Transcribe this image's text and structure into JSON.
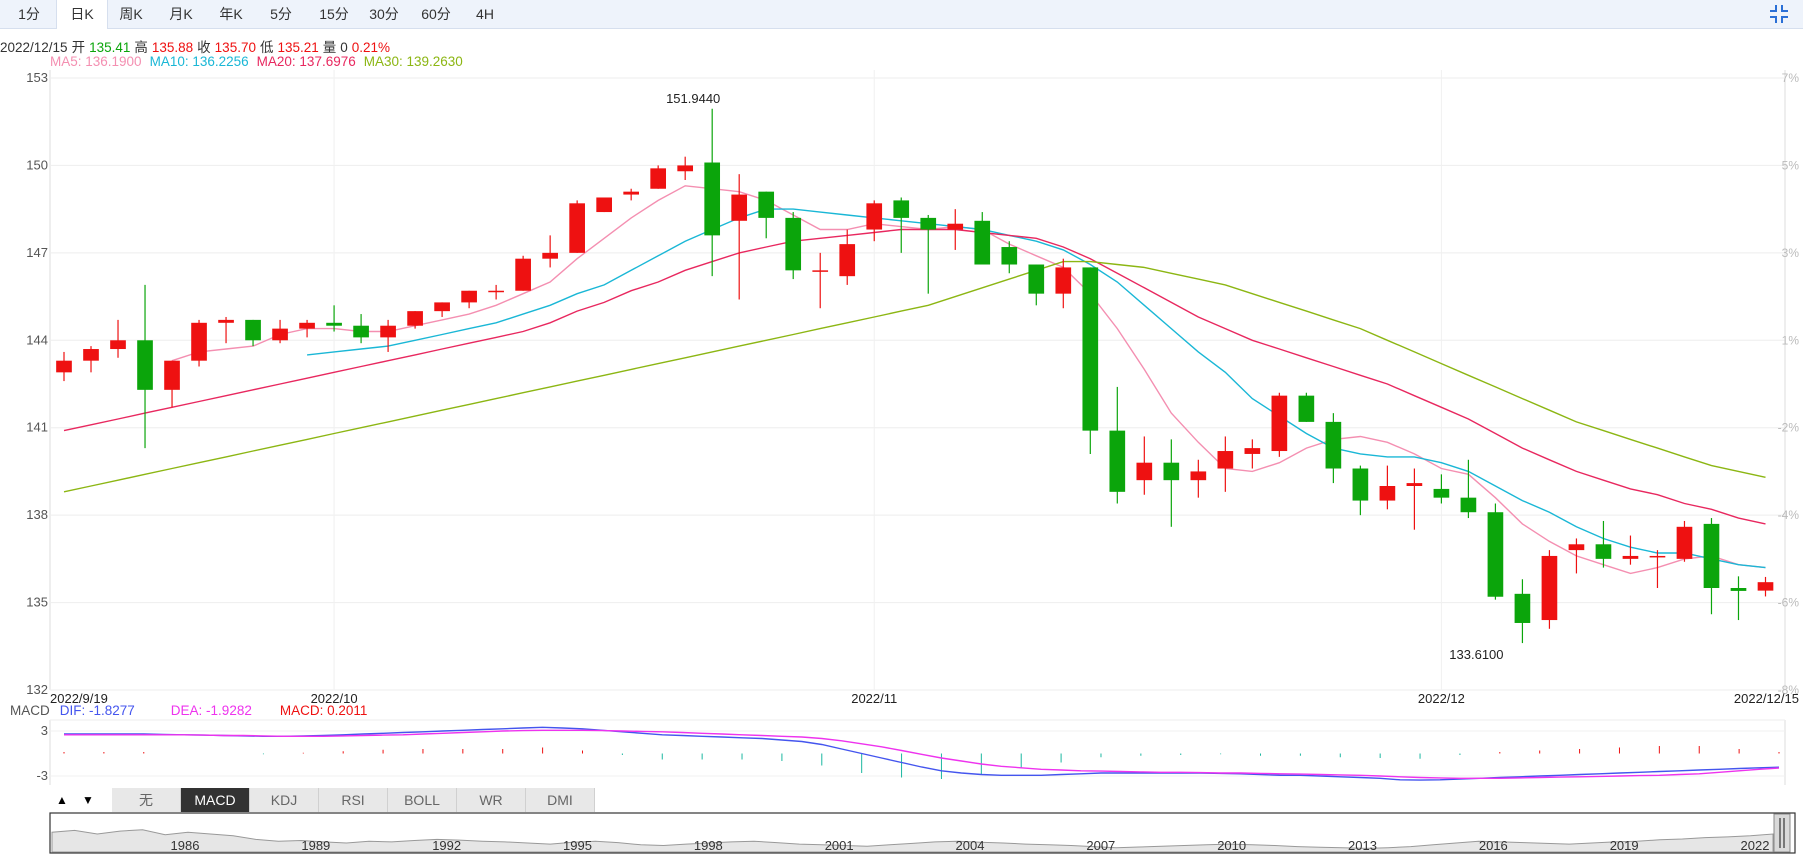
{
  "tabs": [
    "1分",
    "日K",
    "周K",
    "月K",
    "年K",
    "5分",
    "15分",
    "30分",
    "60分",
    "4H"
  ],
  "active_tab": "日K",
  "ohlc": {
    "date": "2022/12/15",
    "open_label": "开",
    "open": "135.41",
    "high_label": "高",
    "high": "135.88",
    "close_label": "收",
    "close": "135.70",
    "low_label": "低",
    "low": "135.21",
    "vol_label": "量",
    "vol": "0",
    "change": "0.21%"
  },
  "ma": {
    "ma5": "MA5: 136.1900",
    "ma10": "MA10: 136.2256",
    "ma20": "MA20: 137.6976",
    "ma30": "MA30: 139.2630"
  },
  "macd": {
    "label": "MACD",
    "dif": "DIF: -1.8277",
    "dea": "DEA: -1.9282",
    "macd": "MACD: 0.2011"
  },
  "indicators": [
    "无",
    "MACD",
    "KDJ",
    "RSI",
    "BOLL",
    "WR",
    "DMI"
  ],
  "active_indicator": "MACD",
  "colors": {
    "up": "#ee1111",
    "down": "#0ba50b",
    "ma5": "#f48fb1",
    "ma10": "#1ab7d6",
    "ma20": "#e8285f",
    "ma30": "#8cb613",
    "dif": "#4455ee",
    "dea": "#ee33ee"
  },
  "chart_data": [
    {
      "type": "candlestick",
      "title": "",
      "ylim": [
        132,
        153
      ],
      "y_ticks": [
        "153",
        "150",
        "147",
        "144",
        "141",
        "138",
        "135",
        "132"
      ],
      "pct_ticks": [
        "7%",
        "5%",
        "3%",
        "1%",
        "-2%",
        "-4%",
        "-6%",
        "-8%"
      ],
      "x_labels": [
        {
          "i": 0,
          "text": "2022/9/19"
        },
        {
          "i": 10,
          "text": "2022/10"
        },
        {
          "i": 30,
          "text": "2022/11"
        },
        {
          "i": 51,
          "text": "2022/12"
        },
        {
          "i": 60,
          "text": "2022/12/15"
        }
      ],
      "annotations": [
        {
          "i": 23,
          "price": 151.944,
          "text": "151.9440"
        },
        {
          "i": 52,
          "price": 133.61,
          "text": "133.6100"
        }
      ],
      "candles": [
        {
          "o": 142.9,
          "h": 143.6,
          "l": 142.6,
          "c": 143.3
        },
        {
          "o": 143.3,
          "h": 143.8,
          "l": 142.9,
          "c": 143.7
        },
        {
          "o": 143.7,
          "h": 144.7,
          "l": 143.4,
          "c": 144.0
        },
        {
          "o": 144.0,
          "h": 145.9,
          "l": 140.3,
          "c": 142.3
        },
        {
          "o": 142.3,
          "h": 143.3,
          "l": 141.7,
          "c": 143.3
        },
        {
          "o": 143.3,
          "h": 144.7,
          "l": 143.1,
          "c": 144.6
        },
        {
          "o": 144.6,
          "h": 144.8,
          "l": 143.9,
          "c": 144.7
        },
        {
          "o": 144.7,
          "h": 144.7,
          "l": 143.8,
          "c": 144.0
        },
        {
          "o": 144.0,
          "h": 144.7,
          "l": 143.9,
          "c": 144.4
        },
        {
          "o": 144.4,
          "h": 144.7,
          "l": 144.1,
          "c": 144.6
        },
        {
          "o": 144.6,
          "h": 145.2,
          "l": 144.3,
          "c": 144.5
        },
        {
          "o": 144.5,
          "h": 144.9,
          "l": 143.9,
          "c": 144.1
        },
        {
          "o": 144.1,
          "h": 144.7,
          "l": 143.6,
          "c": 144.5
        },
        {
          "o": 144.5,
          "h": 145.0,
          "l": 144.4,
          "c": 145.0
        },
        {
          "o": 145.0,
          "h": 145.3,
          "l": 144.8,
          "c": 145.3
        },
        {
          "o": 145.3,
          "h": 145.7,
          "l": 145.1,
          "c": 145.7
        },
        {
          "o": 145.7,
          "h": 145.9,
          "l": 145.4,
          "c": 145.7
        },
        {
          "o": 145.7,
          "h": 146.9,
          "l": 145.7,
          "c": 146.8
        },
        {
          "o": 146.8,
          "h": 147.6,
          "l": 146.5,
          "c": 147.0
        },
        {
          "o": 147.0,
          "h": 148.8,
          "l": 147.0,
          "c": 148.7
        },
        {
          "o": 148.4,
          "h": 148.9,
          "l": 148.4,
          "c": 148.9
        },
        {
          "o": 149.0,
          "h": 149.2,
          "l": 148.8,
          "c": 149.1
        },
        {
          "o": 149.2,
          "h": 150.0,
          "l": 149.2,
          "c": 149.9
        },
        {
          "o": 149.8,
          "h": 150.3,
          "l": 149.5,
          "c": 150.0
        },
        {
          "o": 150.1,
          "h": 151.944,
          "l": 146.2,
          "c": 147.6
        },
        {
          "o": 148.1,
          "h": 149.7,
          "l": 145.4,
          "c": 149.0
        },
        {
          "o": 149.1,
          "h": 149.1,
          "l": 147.5,
          "c": 148.2
        },
        {
          "o": 148.2,
          "h": 148.4,
          "l": 146.1,
          "c": 146.4
        },
        {
          "o": 146.4,
          "h": 147.0,
          "l": 145.1,
          "c": 146.4
        },
        {
          "o": 146.2,
          "h": 147.8,
          "l": 145.9,
          "c": 147.3
        },
        {
          "o": 147.8,
          "h": 148.8,
          "l": 147.4,
          "c": 148.7
        },
        {
          "o": 148.8,
          "h": 148.9,
          "l": 147.0,
          "c": 148.2
        },
        {
          "o": 148.2,
          "h": 148.3,
          "l": 145.6,
          "c": 147.8
        },
        {
          "o": 147.8,
          "h": 148.5,
          "l": 147.1,
          "c": 148.0
        },
        {
          "o": 148.1,
          "h": 148.4,
          "l": 146.7,
          "c": 146.6
        },
        {
          "o": 147.2,
          "h": 147.4,
          "l": 146.3,
          "c": 146.6
        },
        {
          "o": 146.6,
          "h": 146.6,
          "l": 145.2,
          "c": 145.6
        },
        {
          "o": 145.6,
          "h": 146.8,
          "l": 145.1,
          "c": 146.5
        },
        {
          "o": 146.5,
          "h": 146.5,
          "l": 140.1,
          "c": 140.9
        },
        {
          "o": 140.9,
          "h": 142.4,
          "l": 138.4,
          "c": 138.8
        },
        {
          "o": 139.2,
          "h": 140.7,
          "l": 138.7,
          "c": 139.8
        },
        {
          "o": 139.8,
          "h": 140.6,
          "l": 137.6,
          "c": 139.2
        },
        {
          "o": 139.2,
          "h": 139.9,
          "l": 138.6,
          "c": 139.5
        },
        {
          "o": 139.6,
          "h": 140.7,
          "l": 138.8,
          "c": 140.2
        },
        {
          "o": 140.1,
          "h": 140.6,
          "l": 139.6,
          "c": 140.3
        },
        {
          "o": 140.2,
          "h": 142.2,
          "l": 140.0,
          "c": 142.1
        },
        {
          "o": 142.1,
          "h": 142.2,
          "l": 141.2,
          "c": 141.2
        },
        {
          "o": 141.2,
          "h": 141.5,
          "l": 139.1,
          "c": 139.6
        },
        {
          "o": 139.6,
          "h": 139.7,
          "l": 138.0,
          "c": 138.5
        },
        {
          "o": 138.5,
          "h": 139.7,
          "l": 138.2,
          "c": 139.0
        },
        {
          "o": 139.0,
          "h": 139.6,
          "l": 137.5,
          "c": 139.1
        },
        {
          "o": 138.9,
          "h": 139.4,
          "l": 138.4,
          "c": 138.6
        },
        {
          "o": 138.6,
          "h": 139.9,
          "l": 137.9,
          "c": 138.1
        },
        {
          "o": 138.1,
          "h": 138.4,
          "l": 135.1,
          "c": 135.2
        },
        {
          "o": 135.3,
          "h": 135.8,
          "l": 133.61,
          "c": 134.3
        },
        {
          "o": 134.4,
          "h": 136.8,
          "l": 134.1,
          "c": 136.6
        },
        {
          "o": 136.8,
          "h": 137.2,
          "l": 136.0,
          "c": 137.0
        },
        {
          "o": 137.0,
          "h": 137.8,
          "l": 136.2,
          "c": 136.5
        },
        {
          "o": 136.5,
          "h": 137.3,
          "l": 136.3,
          "c": 136.6
        },
        {
          "o": 136.6,
          "h": 136.8,
          "l": 135.5,
          "c": 136.6
        },
        {
          "o": 136.5,
          "h": 137.8,
          "l": 136.4,
          "c": 137.6
        },
        {
          "o": 137.7,
          "h": 137.9,
          "l": 134.6,
          "c": 135.5
        },
        {
          "o": 135.5,
          "h": 135.9,
          "l": 134.4,
          "c": 135.4
        },
        {
          "o": 135.41,
          "h": 135.88,
          "l": 135.21,
          "c": 135.7
        }
      ],
      "ma_series": [
        {
          "name": "MA5",
          "values": [
            null,
            null,
            null,
            null,
            143.3,
            143.6,
            143.7,
            143.8,
            144.2,
            144.4,
            144.4,
            144.3,
            144.3,
            144.5,
            144.7,
            144.9,
            145.2,
            145.6,
            146.0,
            146.8,
            147.5,
            148.2,
            148.8,
            149.3,
            149.2,
            149.1,
            148.8,
            148.3,
            147.8,
            147.8,
            148.0,
            147.9,
            147.8,
            147.9,
            147.8,
            147.3,
            146.9,
            146.5,
            145.6,
            144.4,
            143.0,
            141.5,
            140.5,
            139.6,
            139.5,
            139.8,
            140.3,
            140.6,
            140.7,
            140.5,
            140.1,
            139.6,
            139.4,
            138.6,
            137.7,
            137.1,
            136.6,
            136.3,
            136.0,
            136.2,
            136.5,
            136.6,
            136.3,
            136.2
          ]
        },
        {
          "name": "MA10",
          "values": [
            null,
            null,
            null,
            null,
            null,
            null,
            null,
            null,
            null,
            143.5,
            143.6,
            143.7,
            143.8,
            144.0,
            144.2,
            144.4,
            144.6,
            144.9,
            145.2,
            145.6,
            145.9,
            146.4,
            146.9,
            147.4,
            147.8,
            148.2,
            148.5,
            148.5,
            148.4,
            148.3,
            148.2,
            148.1,
            148.0,
            147.9,
            147.8,
            147.6,
            147.4,
            147.1,
            146.6,
            146.0,
            145.2,
            144.4,
            143.6,
            142.9,
            142.0,
            141.4,
            140.8,
            140.3,
            140.1,
            140.0,
            140.0,
            139.8,
            139.5,
            139.0,
            138.5,
            138.1,
            137.6,
            137.2,
            136.9,
            136.7,
            136.7,
            136.5,
            136.3,
            136.2
          ]
        },
        {
          "name": "MA20",
          "values": [
            140.9,
            141.1,
            141.3,
            141.5,
            141.7,
            141.9,
            142.1,
            142.3,
            142.5,
            142.7,
            142.9,
            143.1,
            143.3,
            143.5,
            143.7,
            143.9,
            144.1,
            144.3,
            144.6,
            145.0,
            145.3,
            145.7,
            146.0,
            146.4,
            146.7,
            147.0,
            147.2,
            147.4,
            147.5,
            147.6,
            147.7,
            147.8,
            147.8,
            147.8,
            147.7,
            147.6,
            147.5,
            147.2,
            146.8,
            146.3,
            145.8,
            145.3,
            144.8,
            144.4,
            144.0,
            143.7,
            143.4,
            143.1,
            142.8,
            142.5,
            142.1,
            141.7,
            141.3,
            140.8,
            140.3,
            139.9,
            139.5,
            139.2,
            138.9,
            138.7,
            138.4,
            138.2,
            137.9,
            137.7
          ]
        },
        {
          "name": "MA30",
          "values": [
            138.8,
            139.0,
            139.2,
            139.4,
            139.6,
            139.8,
            140.0,
            140.2,
            140.4,
            140.6,
            140.8,
            141.0,
            141.2,
            141.4,
            141.6,
            141.8,
            142.0,
            142.2,
            142.4,
            142.6,
            142.8,
            143.0,
            143.2,
            143.4,
            143.6,
            143.8,
            144.0,
            144.2,
            144.4,
            144.6,
            144.8,
            145.0,
            145.2,
            145.5,
            145.8,
            146.1,
            146.4,
            146.7,
            146.7,
            146.6,
            146.5,
            146.3,
            146.1,
            145.9,
            145.6,
            145.3,
            145.0,
            144.7,
            144.4,
            144.0,
            143.6,
            143.2,
            142.8,
            142.4,
            142.0,
            141.6,
            141.2,
            140.9,
            140.6,
            140.3,
            140.0,
            139.7,
            139.5,
            139.3
          ]
        }
      ]
    },
    {
      "type": "macd",
      "ylim": [
        -4.2,
        4.2
      ],
      "y_ticks": [
        "3",
        "-3"
      ],
      "dif": [
        2.6,
        2.6,
        2.6,
        2.6,
        2.6,
        2.55,
        2.5,
        2.45,
        2.4,
        2.35,
        2.3,
        2.3,
        2.35,
        2.4,
        2.5,
        2.6,
        2.7,
        2.8,
        2.9,
        3.0,
        3.1,
        3.2,
        3.3,
        3.4,
        3.5,
        3.4,
        3.3,
        3.1,
        2.9,
        2.7,
        2.5,
        2.4,
        2.3,
        2.2,
        2.1,
        2.0,
        1.8,
        1.6,
        1.2,
        0.6,
        0.0,
        -0.6,
        -1.2,
        -1.8,
        -2.3,
        -2.6,
        -2.8,
        -2.9,
        -2.9,
        -2.9,
        -2.8,
        -2.7,
        -2.6,
        -2.6,
        -2.6,
        -2.6,
        -2.6,
        -2.6,
        -2.65,
        -2.7,
        -2.8,
        -2.9,
        -2.9,
        -3.0,
        -3.1,
        -3.2,
        -3.3,
        -3.5,
        -3.55,
        -3.5,
        -3.4,
        -3.3,
        -3.2,
        -3.1,
        -3.0,
        -2.9,
        -2.8,
        -2.7,
        -2.6,
        -2.5,
        -2.4,
        -2.3,
        -2.2,
        -2.1,
        -2.0,
        -1.9,
        -1.83
      ],
      "dea": [
        2.5,
        2.5,
        2.5,
        2.5,
        2.5,
        2.5,
        2.5,
        2.45,
        2.4,
        2.4,
        2.35,
        2.3,
        2.3,
        2.3,
        2.35,
        2.4,
        2.45,
        2.5,
        2.6,
        2.7,
        2.8,
        2.9,
        3.0,
        3.05,
        3.1,
        3.1,
        3.1,
        3.05,
        3.0,
        2.95,
        2.9,
        2.8,
        2.7,
        2.6,
        2.5,
        2.4,
        2.3,
        2.2,
        2.0,
        1.7,
        1.3,
        0.9,
        0.4,
        -0.1,
        -0.6,
        -1.0,
        -1.4,
        -1.7,
        -1.9,
        -2.1,
        -2.2,
        -2.3,
        -2.35,
        -2.4,
        -2.45,
        -2.5,
        -2.5,
        -2.55,
        -2.6,
        -2.6,
        -2.65,
        -2.7,
        -2.75,
        -2.8,
        -2.85,
        -2.9,
        -3.0,
        -3.1,
        -3.2,
        -3.25,
        -3.3,
        -3.3,
        -3.3,
        -3.25,
        -3.2,
        -3.15,
        -3.1,
        -3.05,
        -3.0,
        -2.95,
        -2.9,
        -2.8,
        -2.7,
        -2.5,
        -2.3,
        -2.1,
        -1.93
      ],
      "hist_step": 1
    },
    {
      "type": "area",
      "x_labels": [
        "1986",
        "1989",
        "1992",
        "1995",
        "1998",
        "2001",
        "2004",
        "2007",
        "2010",
        "2013",
        "2016",
        "2019",
        "2022"
      ],
      "values": [
        0.55,
        0.6,
        0.5,
        0.58,
        0.62,
        0.48,
        0.55,
        0.5,
        0.45,
        0.35,
        0.3,
        0.32,
        0.28,
        0.25,
        0.3,
        0.28,
        0.32,
        0.35,
        0.33,
        0.3,
        0.28,
        0.25,
        0.22,
        0.27,
        0.3,
        0.26,
        0.2,
        0.18,
        0.22,
        0.25,
        0.28,
        0.3,
        0.26,
        0.22,
        0.2,
        0.18,
        0.16,
        0.2,
        0.24,
        0.28,
        0.3,
        0.27,
        0.25,
        0.22,
        0.2,
        0.18,
        0.15,
        0.12,
        0.14,
        0.16,
        0.18,
        0.2,
        0.22,
        0.2,
        0.18,
        0.15,
        0.13,
        0.12,
        0.1,
        0.12,
        0.15,
        0.2,
        0.25,
        0.3,
        0.28,
        0.26,
        0.24,
        0.22,
        0.25,
        0.28,
        0.3,
        0.34,
        0.36,
        0.4,
        0.42,
        0.45,
        0.5
      ]
    }
  ]
}
